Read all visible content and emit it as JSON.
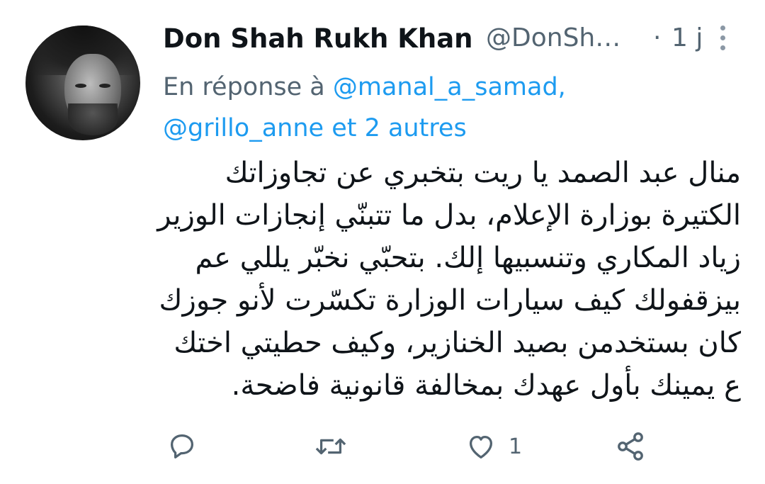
{
  "author": {
    "display_name": "Don Shah Rukh Khan",
    "handle": "@DonSh…",
    "separator": "·",
    "time": "1 j",
    "avatar_icon": "profile-photo"
  },
  "reply_context": {
    "prefix": "En réponse à",
    "mention1": "@manal_a_samad,",
    "mention2": "@grillo_anne",
    "connector": "et 2 autres"
  },
  "tweet": {
    "lines": [
      "منال عبد الصمد يا ريت بتخبري عن تجاوزاتك",
      "الكتيرة بوزارة الإعلام، بدل ما تتبنّي إنجازات الوزير",
      "زياد المكاري وتنسبيها إلك. بتحبّي نخبّر يللي عم",
      "بيزقفولك كيف سيارات الوزارة تكسّرت لأنو جوزك",
      "كان بستخدمن بصيد الخنازير، وكيف حطيتي اختك",
      "ع يمينك بأول عهدك بمخالفة قانونية فاضحة."
    ]
  },
  "actions": {
    "reply_icon": "reply-icon",
    "retweet_icon": "retweet-icon",
    "like_icon": "heart-icon",
    "like_count": "1",
    "share_icon": "share-icon"
  },
  "colors": {
    "accent": "#1d9bf0",
    "secondary_text": "#536471",
    "primary_text": "#0f1419"
  }
}
